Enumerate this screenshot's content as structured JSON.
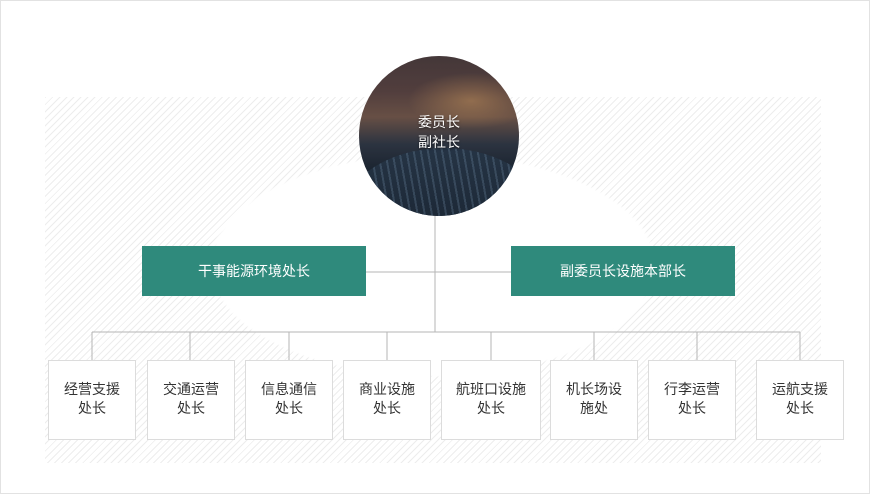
{
  "org_chart": {
    "top": {
      "label": "委员长\n副社长"
    },
    "mid": [
      {
        "label": "干事能源环境处长"
      },
      {
        "label": "副委员长设施本部长"
      }
    ],
    "departments": [
      {
        "label": "经营支援\n处长"
      },
      {
        "label": "交通运营\n处长"
      },
      {
        "label": "信息通信\n处长"
      },
      {
        "label": "商业设施\n处长"
      },
      {
        "label": "航班口设施\n处长"
      },
      {
        "label": "机长场设\n施处"
      },
      {
        "label": "行李运营\n处长"
      },
      {
        "label": "运航支援\n处长"
      }
    ]
  },
  "colors": {
    "mid_box": "#2f8a7c",
    "connector": "#b5b5b5",
    "dept_border": "#dcdcdc"
  }
}
